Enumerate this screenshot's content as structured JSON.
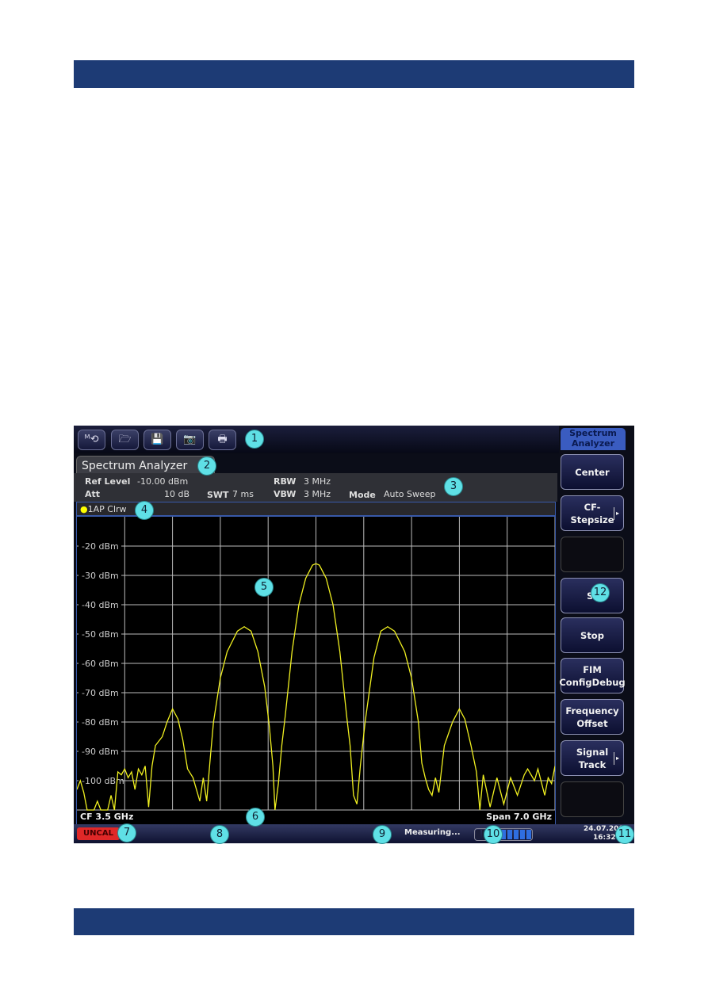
{
  "page": {
    "header_color": "#1d3b75"
  },
  "toolbar": {
    "icons": [
      "mode-icon",
      "open-folder-icon",
      "save-disk-icon",
      "camera-icon",
      "printer-icon"
    ],
    "glyphs": [
      "ᴹ⟲",
      "🗁",
      "💾",
      "📷",
      "🖶"
    ]
  },
  "app": {
    "tab_title": "Spectrum Analyzer"
  },
  "settings": {
    "ref_level_label": "Ref Level",
    "ref_level_value": "-10.00 dBm",
    "att_label": "Att",
    "att_value": "10 dB",
    "swt_label": "SWT",
    "swt_value": "7 ms",
    "rbw_label": "RBW",
    "rbw_value": "3 MHz",
    "vbw_label": "VBW",
    "vbw_value": "3 MHz",
    "mode_label": "Mode",
    "mode_value": "Auto Sweep"
  },
  "trace_label": "1AP Clrw",
  "softkeys": {
    "header": "Spectrum Analyzer",
    "items": [
      {
        "label": "Center"
      },
      {
        "label": "CF-\nStepsize",
        "submenu": true
      },
      {
        "label": ""
      },
      {
        "label": "St"
      },
      {
        "label": "Stop"
      },
      {
        "label": "FIM\nConfigDebug"
      },
      {
        "label": "Frequency\nOffset"
      },
      {
        "label": "Signal\nTrack",
        "submenu": true
      },
      {
        "label": ""
      }
    ]
  },
  "footer": {
    "cf": "CF 3.5 GHz",
    "span": "Span 7.0 GHz"
  },
  "status": {
    "uncal": "UNCAL",
    "measuring": "Measuring...",
    "date": "24.07.200",
    "time": "16:32:",
    "progress_segments_total": 9,
    "progress_segments_filled": 5
  },
  "callouts": [
    "1",
    "2",
    "3",
    "4",
    "5",
    "6",
    "7",
    "8",
    "9",
    "10",
    "11",
    "12"
  ],
  "chart_data": {
    "type": "line",
    "xlim": [
      0,
      7.0
    ],
    "x_unit": "GHz",
    "ylim": [
      -110,
      -10
    ],
    "y_unit": "dBm",
    "y_ticks": [
      "-20 dBm",
      "-30 dBm",
      "-40 dBm",
      "-50 dBm",
      "-60 dBm",
      "-70 dBm",
      "-80 dBm",
      "-90 dBm",
      "-100 dBm"
    ],
    "y_tick_values": [
      -20,
      -30,
      -40,
      -50,
      -60,
      -70,
      -80,
      -90,
      -100
    ],
    "grid": true,
    "trace_color": "#f0f020",
    "x": [
      0.0,
      0.05,
      0.1,
      0.15,
      0.25,
      0.3,
      0.35,
      0.45,
      0.5,
      0.55,
      0.6,
      0.65,
      0.7,
      0.75,
      0.8,
      0.85,
      0.9,
      0.95,
      1.0,
      1.05,
      1.1,
      1.15,
      1.25,
      1.32,
      1.4,
      1.48,
      1.55,
      1.62,
      1.7,
      1.75,
      1.8,
      1.85,
      1.9,
      1.95,
      2.0,
      2.1,
      2.2,
      2.35,
      2.45,
      2.55,
      2.65,
      2.75,
      2.82,
      2.87,
      2.9,
      2.95,
      3.0,
      3.05,
      3.15,
      3.25,
      3.35,
      3.45,
      3.5,
      3.55,
      3.65,
      3.75,
      3.85,
      3.95,
      4.0,
      4.05,
      4.1,
      4.15,
      4.22,
      4.35,
      4.45,
      4.55,
      4.65,
      4.8,
      4.9,
      5.0,
      5.05,
      5.1,
      5.15,
      5.2,
      5.25,
      5.3,
      5.38,
      5.5,
      5.6,
      5.68,
      5.77,
      5.85,
      5.9,
      5.95,
      6.05,
      6.15,
      6.25,
      6.35,
      6.45,
      6.55,
      6.6,
      6.7,
      6.75,
      6.85,
      6.9,
      6.95,
      7.0
    ],
    "y": [
      -103,
      -100,
      -104,
      -110,
      -110,
      -107,
      -110,
      -110,
      -105,
      -110,
      -97,
      -98,
      -96,
      -99,
      -97,
      -103,
      -96,
      -98,
      -95,
      -109,
      -95,
      -88,
      -85,
      -80,
      -75.5,
      -79,
      -86,
      -96,
      -99,
      -103,
      -107,
      -99,
      -107,
      -93,
      -80,
      -65,
      -56,
      -49,
      -47.5,
      -49,
      -56,
      -68,
      -82,
      -95,
      -110,
      -101,
      -88,
      -78,
      -56,
      -40,
      -31,
      -26.5,
      -26,
      -26.5,
      -31,
      -40,
      -56,
      -78,
      -88,
      -105,
      -108,
      -95,
      -80,
      -58,
      -49,
      -47.5,
      -49,
      -56,
      -65,
      -80,
      -94,
      -99,
      -103,
      -105,
      -99,
      -104,
      -88,
      -80,
      -75.5,
      -79,
      -88,
      -97,
      -110,
      -98,
      -109,
      -99,
      -108,
      -99,
      -105,
      -98,
      -96,
      -100,
      -96,
      -105,
      -99,
      -101,
      -95
    ]
  }
}
